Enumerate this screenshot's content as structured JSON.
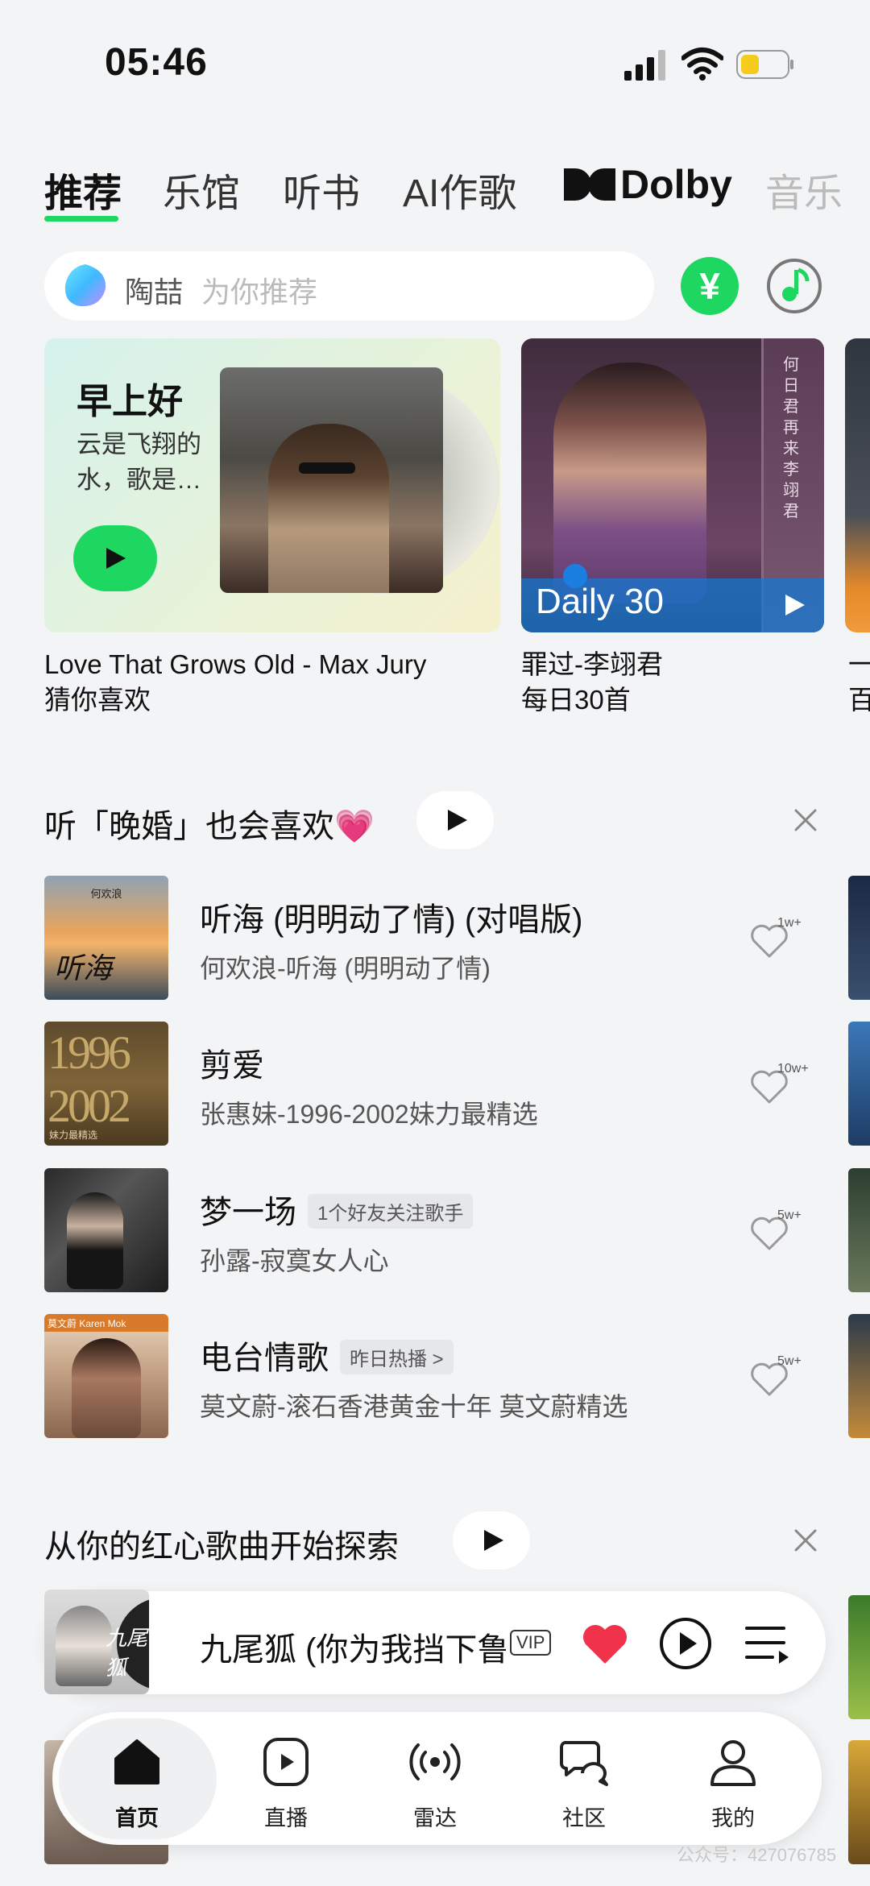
{
  "status": {
    "time": "05:46"
  },
  "tabs": [
    {
      "label": "推荐",
      "active": true
    },
    {
      "label": "乐馆"
    },
    {
      "label": "听书"
    },
    {
      "label": "AI作歌"
    },
    {
      "label": "Dolby"
    },
    {
      "label": "音乐"
    }
  ],
  "search": {
    "name": "陶喆",
    "hint": "为你推荐"
  },
  "quick_actions": {
    "yen_icon": "¥"
  },
  "cards": [
    {
      "greeting": "早上好",
      "desc": "云是飞翔的水，歌是…",
      "caption_title": "Love That Grows Old - Max Jury",
      "caption_sub": "猜你喜欢"
    },
    {
      "banner": "Daily 30",
      "vertical_text": "何日君再来 李翊君",
      "caption_title": "罪过-李翊君",
      "caption_sub": "每日30首"
    },
    {
      "caption_title": "一",
      "caption_sub": "百"
    }
  ],
  "section1": {
    "title": "听「晚婚」也会喜欢💗",
    "songs": [
      {
        "title": "听海 (明明动了情) (对唱版)",
        "subtitle": "何欢浪-听海 (明明动了情)",
        "likes": "1w+",
        "tag": ""
      },
      {
        "title": "剪爱",
        "subtitle": "张惠妹-1996-2002妹力最精选",
        "likes": "10w+",
        "tag": ""
      },
      {
        "title": "梦一场",
        "subtitle": "孙露-寂寞女人心",
        "likes": "5w+",
        "tag": "1个好友关注歌手"
      },
      {
        "title": "电台情歌",
        "subtitle": "莫文蔚-滚石香港黄金十年 莫文蔚精选",
        "likes": "5w+",
        "tag": "昨日热播 >"
      }
    ],
    "cover_texts": {
      "c1_top": "何欢浪",
      "c1_script": "听海",
      "c2_years": "1996 2002",
      "c2_bottom": "妹力最精选",
      "c4_top": "莫文蔚 Karen Mok"
    }
  },
  "section2": {
    "title": "从你的红心歌曲开始探索"
  },
  "mini_player": {
    "title": "九尾狐 (你为我挡下鲁",
    "badge": "VIP",
    "cover_text": "九尾狐"
  },
  "nav": [
    {
      "label": "首页",
      "icon": "home-icon",
      "active": true
    },
    {
      "label": "直播",
      "icon": "live-play-icon"
    },
    {
      "label": "雷达",
      "icon": "radar-icon"
    },
    {
      "label": "社区",
      "icon": "community-icon"
    },
    {
      "label": "我的",
      "icon": "profile-icon"
    }
  ],
  "watermark": "公众号：427076785",
  "colors": {
    "accent": "#1ed760",
    "heart": "#f0324b",
    "daily_banner": "#1478d2"
  }
}
